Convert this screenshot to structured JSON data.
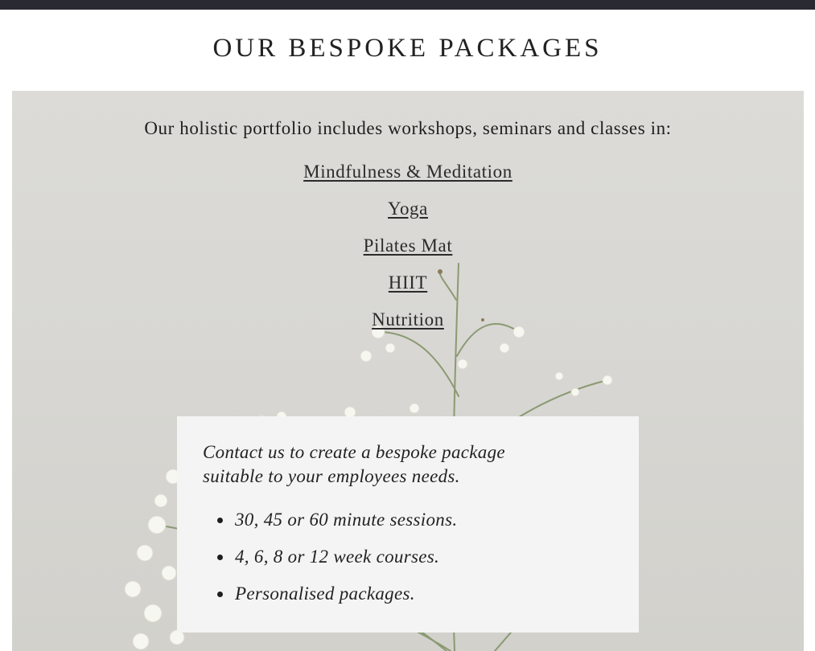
{
  "header": {
    "title": "OUR BESPOKE PACKAGES"
  },
  "hero": {
    "background_image": "white-gypsophila-flowers-photo",
    "intro": "Our holistic portfolio includes workshops, seminars and classes in:",
    "links": [
      {
        "label": "Mindfulness & Meditation"
      },
      {
        "label": "Yoga"
      },
      {
        "label": "Pilates Mat"
      },
      {
        "label": "HIIT"
      },
      {
        "label": "Nutrition"
      }
    ]
  },
  "contact": {
    "text": "Contact us to create a bespoke package suitable to your employees needs.",
    "bullets": [
      "30, 45 or 60 minute sessions.",
      "4, 6, 8 or 12 week courses.",
      "Personalised packages."
    ]
  },
  "colors": {
    "topbar": "#2a2a33",
    "hero_bg": "#d8d7d3",
    "box_bg": "#f4f4f4",
    "text": "#1f1f1f"
  }
}
